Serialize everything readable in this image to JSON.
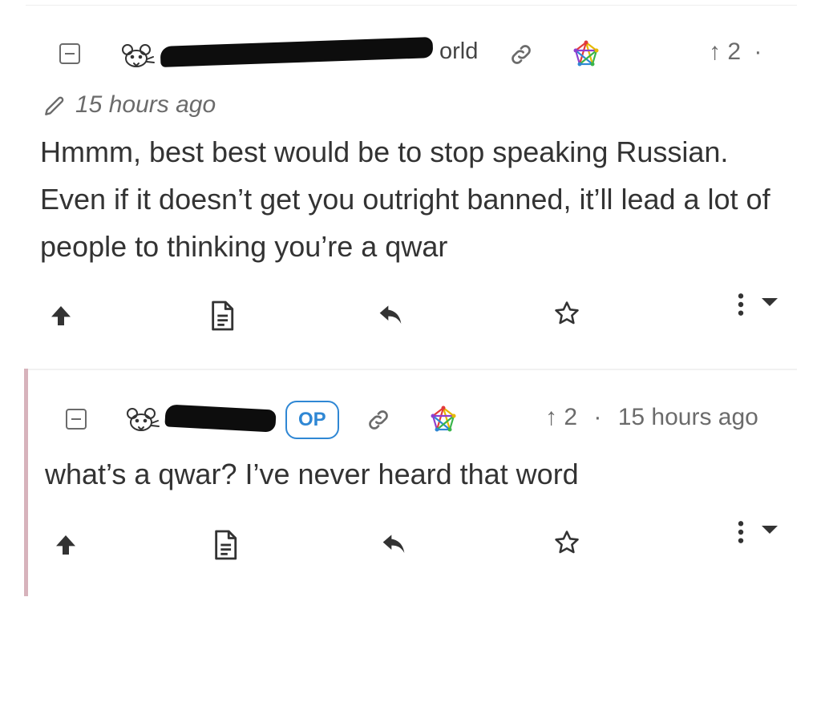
{
  "comments": [
    {
      "username_visible": "orld",
      "upvote_arrow": "↑",
      "score": "2",
      "separator": "·",
      "timestamp": "15 hours ago",
      "body": "Hmmm, best best would be to stop speaking Russian. Even if it doesn’t get you outright banned, it’ll lead a lot of people to thinking you’re a qwar"
    },
    {
      "op_badge": "OP",
      "upvote_arrow": "↑",
      "score": "2",
      "separator": "·",
      "timestamp": "15 hours ago",
      "body": "what’s a qwar? I’ve never heard that word"
    }
  ],
  "icons": {
    "collapse": "minus-square-icon",
    "avatar": "rat-face-icon",
    "link": "link-icon",
    "fediverse": "fediverse-pentagram-icon",
    "edited": "pencil-icon",
    "upvote": "arrow-up-icon",
    "view_source": "document-icon",
    "reply": "reply-arrow-icon",
    "save": "star-icon",
    "more": "vertical-dots-icon",
    "dropdown": "caret-down-icon"
  },
  "colors": {
    "op_badge": "#2f87d4",
    "thread_border": "#d7b3bc",
    "text": "#333333",
    "meta": "#6b6b6b"
  }
}
